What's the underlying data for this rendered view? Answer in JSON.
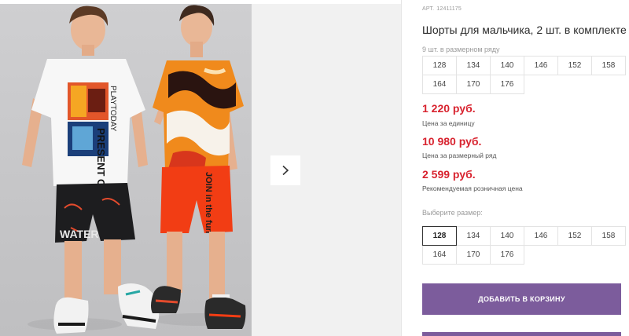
{
  "product": {
    "article_label": "АРТ.",
    "article_number": "12411175",
    "title": "Шорты для мальчика, 2 шт. в комплекте"
  },
  "size_row": {
    "label": "9 шт. в размерном ряду",
    "sizes": [
      "128",
      "134",
      "140",
      "146",
      "152",
      "158",
      "164",
      "170",
      "176"
    ]
  },
  "prices": [
    {
      "value": "1 220 руб.",
      "caption": "Цена за единицу"
    },
    {
      "value": "10 980 руб.",
      "caption": "Цена за размерный ряд"
    },
    {
      "value": "2 599 руб.",
      "caption": "Рекомендуемая розничная цена"
    }
  ],
  "size_select": {
    "label": "Выберите размер:",
    "sizes": [
      "128",
      "134",
      "140",
      "146",
      "152",
      "158",
      "164",
      "170",
      "176"
    ],
    "selected": "128"
  },
  "cart": {
    "add_label": "ДОБАВИТЬ В КОРЗИНУ"
  },
  "gallery": {
    "next_icon": "chevron-right-icon",
    "shirt_print_text": "PRESENT OF",
    "shirt_brand_text": "PLAYTODAY",
    "shorts_text_left": "WATER",
    "shorts_text_right": "JOIN in the fun"
  },
  "colors": {
    "price_red": "#d8232f",
    "button_purple": "#7c5c9c",
    "border": "#e3e3e3"
  }
}
